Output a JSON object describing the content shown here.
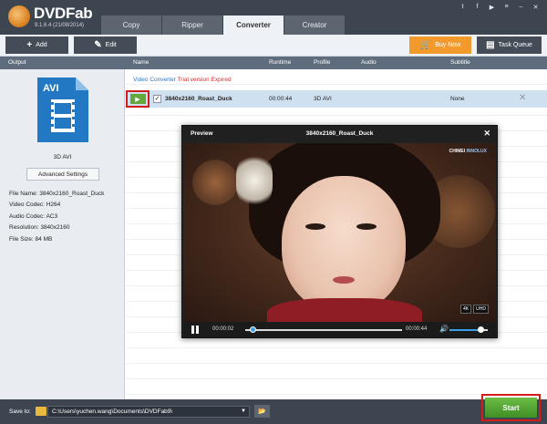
{
  "app": {
    "logo_text": "DVDFab",
    "version": "9.1.6.4 (21/08/2014)"
  },
  "tabs": [
    {
      "label": "Copy",
      "active": false
    },
    {
      "label": "Ripper",
      "active": false
    },
    {
      "label": "Converter",
      "active": true
    },
    {
      "label": "Creator",
      "active": false
    }
  ],
  "top_icons": [
    "twitter-icon",
    "facebook-icon",
    "youtube-icon",
    "menu-icon",
    "minimize-icon",
    "close-icon"
  ],
  "toolbar": {
    "add_label": "Add",
    "edit_label": "Edit",
    "buy_label": "Buy Now",
    "queue_label": "Task Queue"
  },
  "columns": {
    "output": "Output",
    "name": "Name",
    "runtime": "Runtime",
    "profile": "Profile",
    "audio": "Audio",
    "subtitle": "Subtitle"
  },
  "left_panel": {
    "file_type": "AVI",
    "format_label": "3D AVI",
    "advanced_button": "Advanced Settings",
    "info": [
      "File Name: 3840x2160_Roast_Duck",
      "Video Codec: H264",
      "Audio Codec: AC3",
      "Resolution: 3840x2160",
      "File Size: 84 MB"
    ]
  },
  "main": {
    "converter_label": "Video Converter",
    "trial_label": "Trial version",
    "expired_label": "Expired",
    "row": {
      "name": "3840x2160_Roast_Duck",
      "runtime": "00:00:44",
      "profile": "3D AVI",
      "subtitle": "None",
      "checked": true
    }
  },
  "preview": {
    "label": "Preview",
    "title": "3840x2160_Roast_Duck",
    "channel_logo_a": "CHIMEI",
    "channel_logo_b": "INNOLUX",
    "badges": [
      "4K",
      "UHD"
    ],
    "current_time": "00:00:02",
    "end_time": "00:00:44",
    "progress": 0.045,
    "volume": 0.8
  },
  "footer": {
    "save_label": "Save to:",
    "path": "C:\\Users\\yuchen.wang\\Documents\\DVDFab9\\",
    "start_label": "Start"
  },
  "colors": {
    "header": "#3d4550",
    "column_header": "#5e6c7d",
    "buy_orange": "#f39a2d",
    "start_green": "#4fa030",
    "highlight_red": "#d11c1c",
    "avi_blue": "#2378c4"
  }
}
